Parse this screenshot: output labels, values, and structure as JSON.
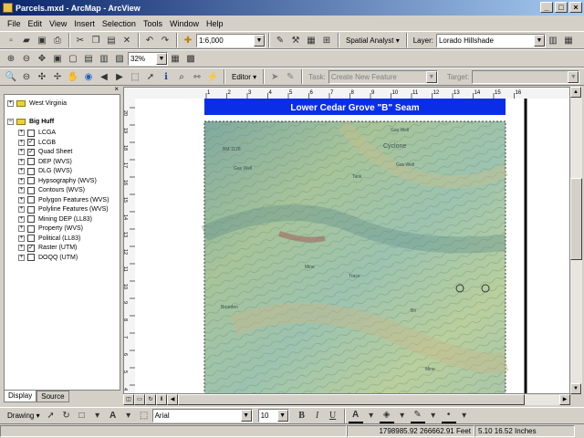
{
  "window": {
    "title": "Parcels.mxd - ArcMap - ArcView"
  },
  "menu": [
    "File",
    "Edit",
    "View",
    "Insert",
    "Selection",
    "Tools",
    "Window",
    "Help"
  ],
  "toolbar": {
    "scale": "1:6,000",
    "spatial_analyst": "Spatial Analyst",
    "layer_label": "Layer:",
    "layer_value": "Lorado Hillshade",
    "zoom_percent": "32%",
    "editor": "Editor",
    "task_label": "Task:",
    "task_value": "Create New Feature",
    "target_label": "Target:"
  },
  "toc": {
    "groups": [
      {
        "name": "West Virginia",
        "expanded": false,
        "layers": []
      },
      {
        "name": "Big Huff",
        "expanded": true,
        "layers": [
          {
            "name": "LCGA",
            "checked": false
          },
          {
            "name": "LCGB",
            "checked": true
          },
          {
            "name": "Quad Sheet",
            "checked": true
          },
          {
            "name": "DEP (WVS)",
            "checked": false
          },
          {
            "name": "DLG (WVS)",
            "checked": false
          },
          {
            "name": "Hypsography (WVS)",
            "checked": false
          },
          {
            "name": "Contours (WVS)",
            "checked": false
          },
          {
            "name": "Polygon Features (WVS)",
            "checked": false
          },
          {
            "name": "Polyline Features (WVS)",
            "checked": false
          },
          {
            "name": "Mining DEP (LL83)",
            "checked": false
          },
          {
            "name": "Property (WVS)",
            "checked": false
          },
          {
            "name": "Political (LL83)",
            "checked": false
          },
          {
            "name": "Raster (UTM)",
            "checked": true
          },
          {
            "name": "DOQQ (UTM)",
            "checked": false
          }
        ]
      }
    ],
    "tabs": [
      "Display",
      "Source"
    ]
  },
  "ruler": {
    "h_ticks": [
      "1",
      "2",
      "3",
      "4",
      "5",
      "6",
      "7",
      "8",
      "9",
      "10",
      "11",
      "12",
      "13",
      "14",
      "15",
      "16"
    ],
    "v_ticks": [
      "20",
      "19",
      "18",
      "17",
      "16",
      "15",
      "14",
      "13",
      "12",
      "11",
      "10",
      "9",
      "8",
      "7",
      "6",
      "5",
      "4"
    ]
  },
  "map": {
    "title": "Lower Cedar Grove \"B\" Seam",
    "labels": [
      "BM 1128",
      "Cyclone",
      "Gas Well",
      "Gas Well",
      "Gas Well",
      "Tank",
      "Mine",
      "Trace",
      "Breeden",
      "Bn",
      "Mine"
    ]
  },
  "drawing": {
    "label": "Drawing",
    "font": "Arial",
    "size": "10",
    "bold": "B",
    "italic": "I",
    "underline": "U",
    "text_tool": "A"
  },
  "status": {
    "coords": "1798985.92  266662.91 Feet",
    "page": "5.10  16.52 Inches"
  },
  "colors": {
    "title_bar": "#0a246a",
    "map_title_bg": "#0a2ee8",
    "map_title_text": "#ffffff"
  }
}
